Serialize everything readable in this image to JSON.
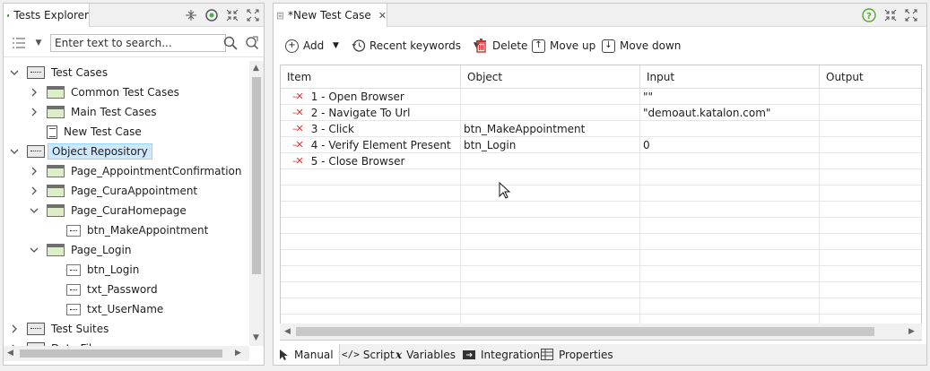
{
  "explorer": {
    "title": "Tests Explorer",
    "search_placeholder": "Enter text to search...",
    "tree": [
      {
        "label": "Test Cases",
        "icon": "test-cases-folder-icon",
        "expanded": true,
        "level": 0,
        "type": "repo"
      },
      {
        "label": "Common Test Cases",
        "icon": "folder-icon",
        "expanded": false,
        "level": 1,
        "type": "folder"
      },
      {
        "label": "Main Test Cases",
        "icon": "folder-icon",
        "expanded": false,
        "level": 1,
        "type": "folder"
      },
      {
        "label": "New Test Case",
        "icon": "test-case-icon",
        "level": 1,
        "type": "tcase"
      },
      {
        "label": "Object Repository",
        "icon": "object-repository-icon",
        "expanded": true,
        "level": 0,
        "type": "repo",
        "selected": true
      },
      {
        "label": "Page_AppointmentConfirmation",
        "icon": "folder-icon",
        "expanded": false,
        "level": 1,
        "type": "folder"
      },
      {
        "label": "Page_CuraAppointment",
        "icon": "folder-icon",
        "expanded": false,
        "level": 1,
        "type": "folder"
      },
      {
        "label": "Page_CuraHomepage",
        "icon": "folder-icon",
        "expanded": true,
        "level": 1,
        "type": "folder"
      },
      {
        "label": "btn_MakeAppointment",
        "icon": "test-object-icon",
        "level": 2,
        "type": "obj"
      },
      {
        "label": "Page_Login",
        "icon": "folder-icon",
        "expanded": true,
        "level": 1,
        "type": "folder"
      },
      {
        "label": "btn_Login",
        "icon": "test-object-icon",
        "level": 2,
        "type": "obj"
      },
      {
        "label": "txt_Password",
        "icon": "test-object-icon",
        "level": 2,
        "type": "obj"
      },
      {
        "label": "txt_UserName",
        "icon": "test-object-icon",
        "level": 2,
        "type": "obj"
      },
      {
        "label": "Test Suites",
        "icon": "test-suites-icon",
        "expanded": false,
        "level": 0,
        "type": "repo"
      },
      {
        "label": "Data Files",
        "icon": "data-files-icon",
        "expanded": false,
        "level": 0,
        "type": "repo"
      }
    ]
  },
  "editor": {
    "tab_title": "*New Test Case",
    "toolbar": {
      "add": "Add",
      "recent_keywords": "Recent keywords",
      "delete": "Delete",
      "move_up": "Move up",
      "move_down": "Move down"
    },
    "columns": [
      "Item",
      "Object",
      "Input",
      "Output"
    ],
    "rows": [
      {
        "item": "1 - Open Browser",
        "object": "",
        "input": "\"\"",
        "output": ""
      },
      {
        "item": "2 - Navigate To Url",
        "object": "",
        "input": "\"demoaut.katalon.com\"",
        "output": ""
      },
      {
        "item": "3 - Click",
        "object": "btn_MakeAppointment",
        "input": "",
        "output": ""
      },
      {
        "item": "4 - Verify Element Present",
        "object": "btn_Login",
        "input": "0",
        "output": ""
      },
      {
        "item": "5 - Close Browser",
        "object": "",
        "input": "",
        "output": ""
      }
    ],
    "bottom_tabs": [
      "Manual",
      "Script",
      "Variables",
      "Integration",
      "Properties"
    ],
    "active_bottom_tab": "Manual"
  },
  "colors": {
    "selection": "#cde8ff",
    "step_icon": "#dd3333",
    "folder_fill": "#dcedc8"
  }
}
